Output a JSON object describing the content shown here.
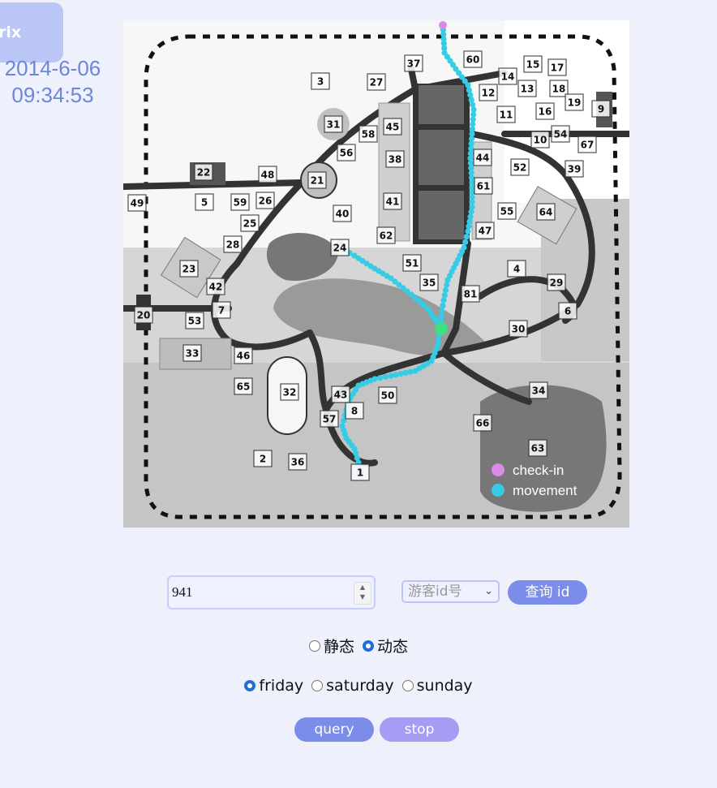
{
  "header": {
    "logo_text": "rix",
    "date": "2014-6-06",
    "time": "09:34:53"
  },
  "map": {
    "location_labels": [
      "1",
      "2",
      "3",
      "4",
      "5",
      "6",
      "7",
      "8",
      "9",
      "10",
      "11",
      "12",
      "13",
      "14",
      "15",
      "16",
      "17",
      "18",
      "19",
      "20",
      "21",
      "22",
      "23",
      "24",
      "25",
      "26",
      "27",
      "28",
      "29",
      "30",
      "31",
      "32",
      "33",
      "34",
      "35",
      "36",
      "37",
      "38",
      "39",
      "40",
      "41",
      "42",
      "43",
      "44",
      "45",
      "46",
      "47",
      "48",
      "49",
      "50",
      "51",
      "52",
      "53",
      "54",
      "55",
      "56",
      "57",
      "58",
      "59",
      "60",
      "61",
      "62",
      "63",
      "64",
      "65",
      "66",
      "67",
      "81"
    ],
    "legend": {
      "checkin": "check-in",
      "movement": "movement"
    },
    "colors": {
      "checkin": "#d98be6",
      "movement": "#36cce6",
      "current": "#3fe07f"
    }
  },
  "controls": {
    "id_value": "941",
    "select_placeholder": "游客id号",
    "query_id_label": "查询 id",
    "mode": {
      "static": "静态",
      "dynamic": "动态"
    },
    "days": {
      "friday": "friday",
      "saturday": "saturday",
      "sunday": "sunday"
    },
    "query_label": "query",
    "stop_label": "stop"
  }
}
